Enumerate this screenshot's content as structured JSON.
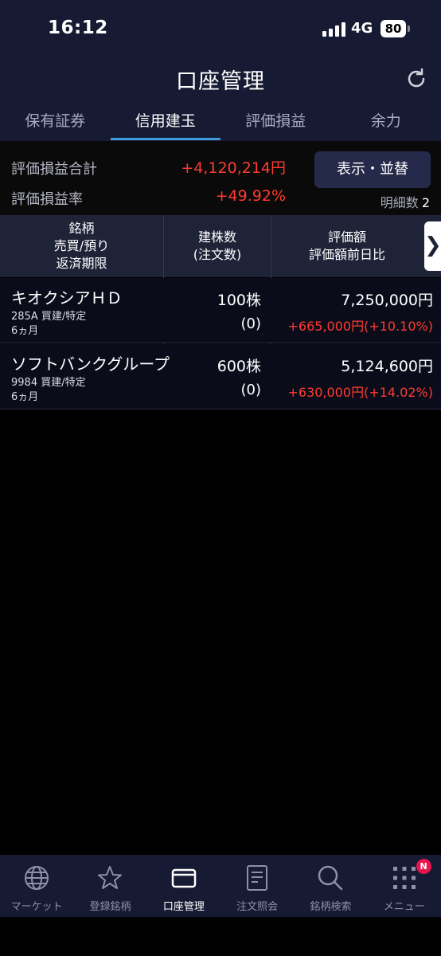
{
  "status_bar": {
    "time": "16:12",
    "network": "4G",
    "battery": "80"
  },
  "header": {
    "title": "口座管理"
  },
  "tabs": [
    {
      "label": "保有証券",
      "active": false
    },
    {
      "label": "信用建玉",
      "active": true
    },
    {
      "label": "評価損益",
      "active": false
    },
    {
      "label": "余力",
      "active": false
    }
  ],
  "summary": {
    "total_label": "評価損益合計",
    "total_value": "+4,120,214円",
    "rate_label": "評価損益率",
    "rate_value": "+49.92%",
    "display_button": "表示・並替",
    "detail_count_label": "明細数",
    "detail_count": "2"
  },
  "table": {
    "headers": {
      "col1": [
        "銘柄",
        "売買/預り",
        "返済期限"
      ],
      "col2": [
        "建株数",
        "(注文数)"
      ],
      "col3": [
        "評価額",
        "評価額前日比"
      ]
    },
    "rows": [
      {
        "name": "キオクシアＨＤ",
        "code_type": "285A 買建/特定",
        "term": "6ヵ月",
        "quantity": "100株",
        "order_qty": "(0)",
        "valuation": "7,250,000円",
        "change": "+665,000円(+10.10%)"
      },
      {
        "name": "ソフトバンクグループ",
        "code_type": "9984 買建/特定",
        "term": "6ヵ月",
        "quantity": "600株",
        "order_qty": "(0)",
        "valuation": "5,124,600円",
        "change": "+630,000円(+14.02%)"
      }
    ]
  },
  "bottom_nav": [
    {
      "label": "マーケット",
      "icon": "globe-icon",
      "active": false
    },
    {
      "label": "登録銘柄",
      "icon": "star-icon",
      "active": false
    },
    {
      "label": "口座管理",
      "icon": "card-icon",
      "active": true
    },
    {
      "label": "注文照会",
      "icon": "document-icon",
      "active": false
    },
    {
      "label": "銘柄検索",
      "icon": "search-icon",
      "active": false
    },
    {
      "label": "メニュー",
      "icon": "grid-menu-icon",
      "active": false,
      "badge": "N"
    }
  ],
  "colors": {
    "accent": "#3d9bdc",
    "positive": "#ff3b30",
    "header_bg": "#171a33"
  }
}
